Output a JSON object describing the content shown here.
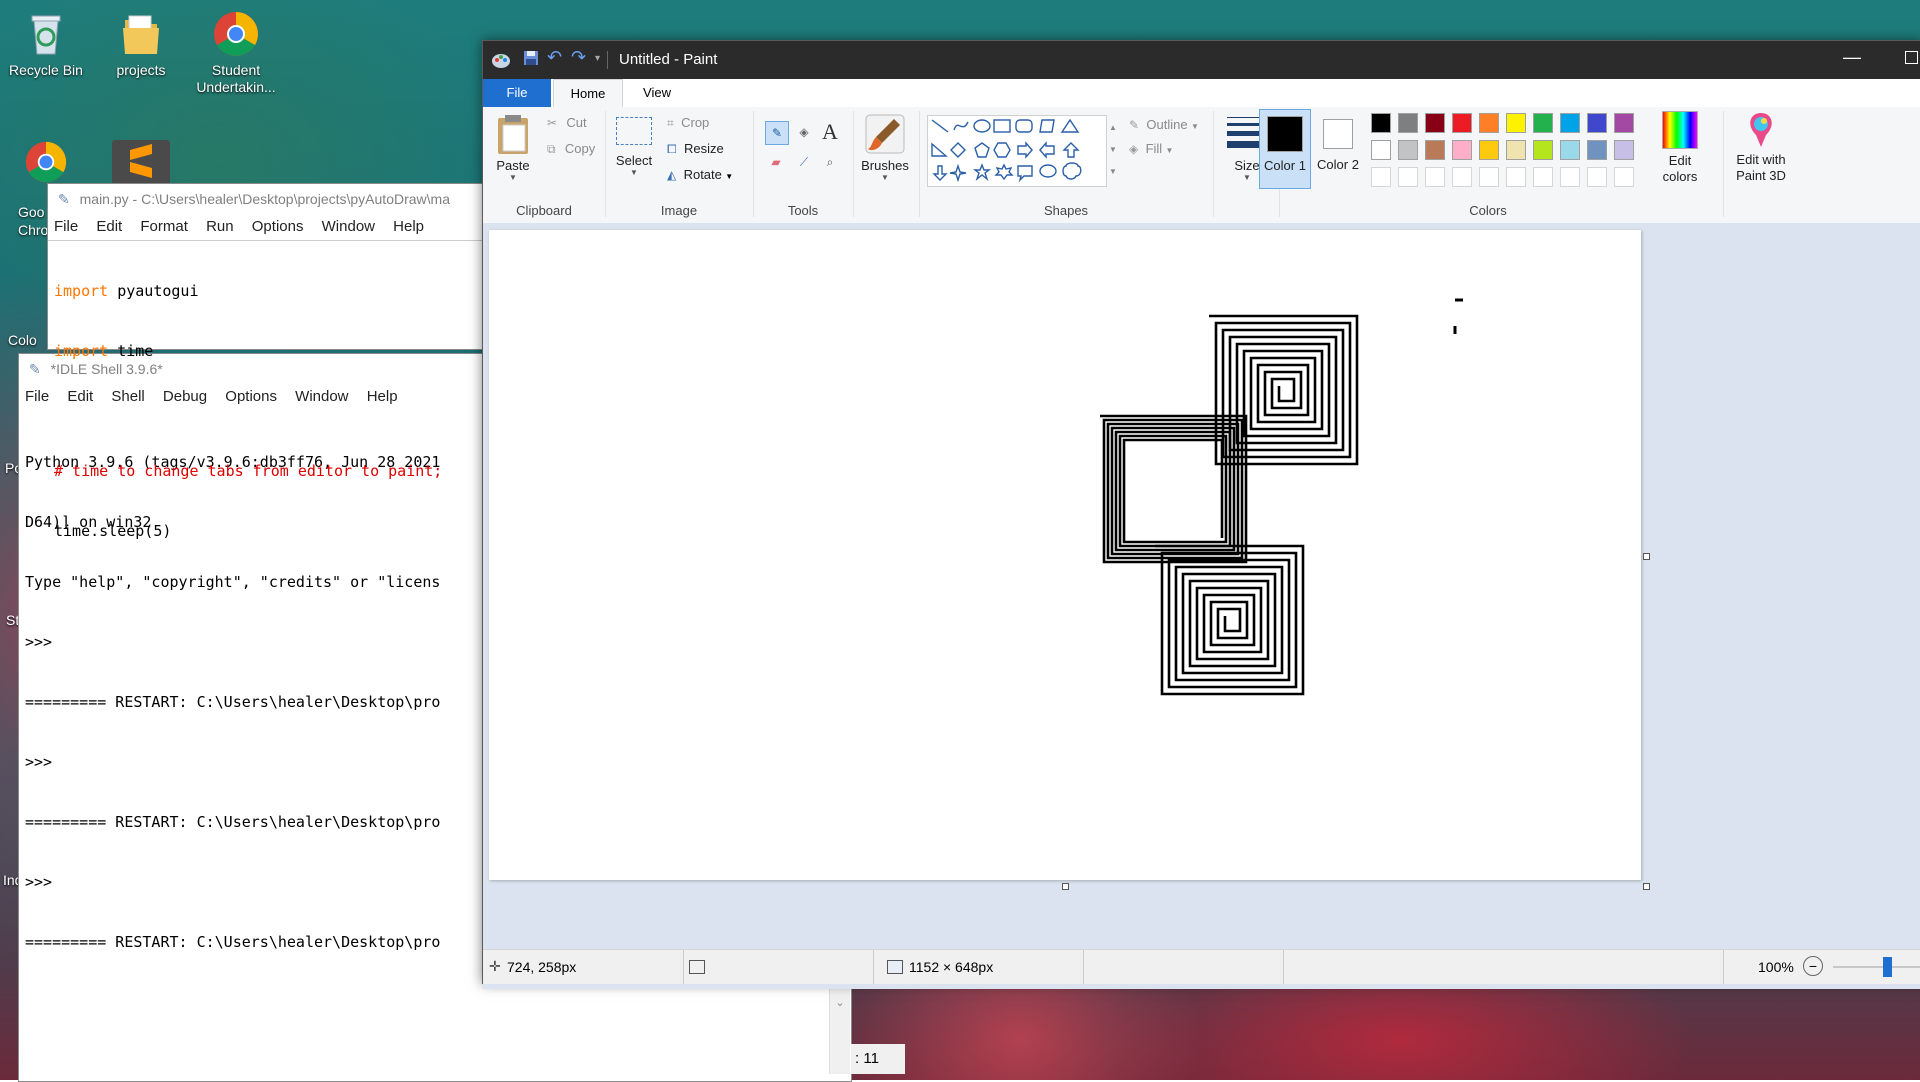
{
  "desktop": {
    "icons": [
      {
        "label": "Recycle Bin",
        "icon": "recycle-bin-icon"
      },
      {
        "label": "projects",
        "icon": "folder-icon"
      },
      {
        "label": "Student Undertakin...",
        "icon": "chrome-icon"
      }
    ],
    "partial_labels": [
      "Goo",
      "Chro",
      "Colo",
      "Po",
      "St",
      "Ind"
    ]
  },
  "editor": {
    "title": "main.py - C:\\Users\\healer\\Desktop\\projects\\pyAutoDraw\\ma",
    "menu": [
      "File",
      "Edit",
      "Format",
      "Run",
      "Options",
      "Window",
      "Help"
    ],
    "lines": [
      {
        "kw": "import",
        "rest": " pyautogui"
      },
      {
        "kw": "import",
        "rest": " time"
      },
      {
        "comment": "# time to change tabs from editor to paint;"
      },
      {
        "text": "time.sleep(5)"
      }
    ]
  },
  "shell": {
    "title": "*IDLE Shell 3.9.6*",
    "menu": [
      "File",
      "Edit",
      "Shell",
      "Debug",
      "Options",
      "Window",
      "Help"
    ],
    "lines": [
      "Python 3.9.6 (tags/v3.9.6:db3ff76, Jun 28 2021",
      "D64)] on win32",
      "Type \"help\", \"copyright\", \"credits\" or \"licens",
      ">>>",
      "========= RESTART: C:\\Users\\healer\\Desktop\\pro",
      ">>>",
      "========= RESTART: C:\\Users\\healer\\Desktop\\pro",
      ">>>",
      "========= RESTART: C:\\Users\\healer\\Desktop\\pro"
    ],
    "status_fragment": ": 11"
  },
  "paint": {
    "title": "Untitled - Paint",
    "tabs": {
      "file": "File",
      "home": "Home",
      "view": "View"
    },
    "clipboard": {
      "paste": "Paste",
      "cut": "Cut",
      "copy": "Copy",
      "group": "Clipboard"
    },
    "image": {
      "select": "Select",
      "crop": "Crop",
      "resize": "Resize",
      "rotate": "Rotate",
      "group": "Image"
    },
    "tools": {
      "group": "Tools"
    },
    "brushes": {
      "label": "Brushes"
    },
    "shapes": {
      "group": "Shapes",
      "outline": "Outline",
      "fill": "Fill"
    },
    "size": {
      "label": "Size"
    },
    "colors": {
      "color1": "Color 1",
      "color2": "Color 2",
      "group": "Colors",
      "edit_colors": "Edit colors",
      "edit_paint3d": "Edit with Paint 3D",
      "color1_value": "#000000",
      "color2_value": "#ffffff",
      "palette_row1": [
        "#000000",
        "#7f7f7f",
        "#880015",
        "#ed1c24",
        "#ff7f27",
        "#fff200",
        "#22b14c",
        "#00a2e8",
        "#3f48cc",
        "#a349a4"
      ],
      "palette_row2": [
        "#ffffff",
        "#c3c3c3",
        "#b97a57",
        "#ffaec9",
        "#ffc90e",
        "#efe4b0",
        "#b5e61d",
        "#99d9ea",
        "#7092be",
        "#c8bfe7"
      ]
    },
    "status": {
      "position": "724, 258px",
      "canvas_size": "1152 × 648px",
      "zoom": "100%"
    }
  }
}
